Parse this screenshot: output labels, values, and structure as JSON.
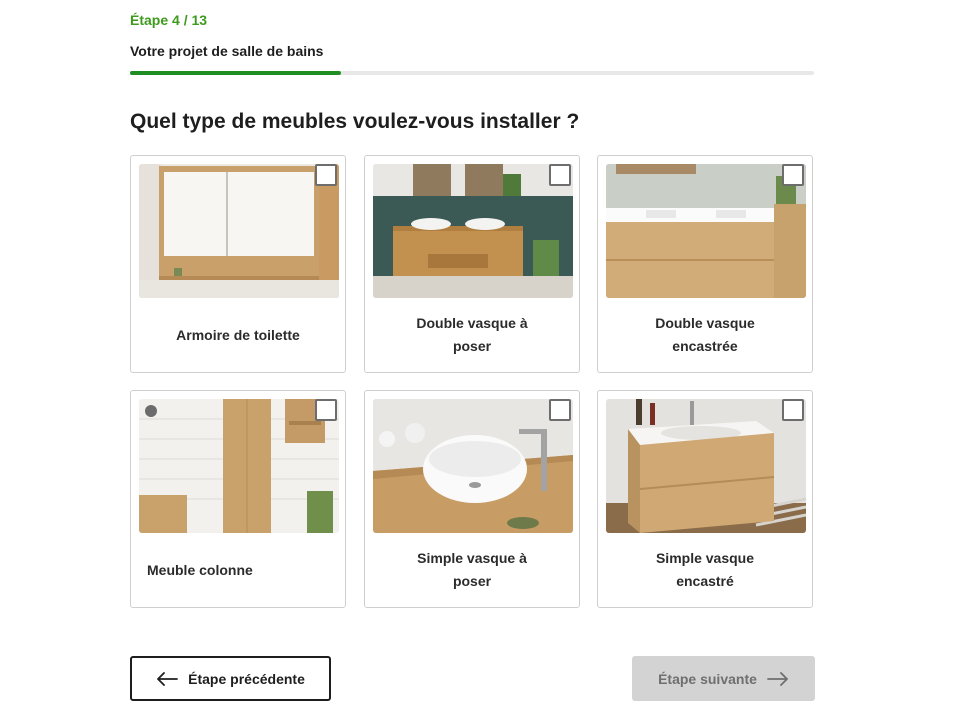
{
  "header": {
    "step": "Étape 4 / 13",
    "project_title": "Votre projet de salle de bains",
    "progress_fraction": 0.308
  },
  "question": "Quel type de meubles voulez-vous installer ?",
  "options": [
    {
      "label": "Armoire de toilette",
      "checked": false
    },
    {
      "label": "Double vasque à poser",
      "checked": false
    },
    {
      "label": "Double vasque encastrée",
      "checked": false
    },
    {
      "label": "Meuble colonne",
      "checked": false
    },
    {
      "label": "Simple vasque à poser",
      "checked": false
    },
    {
      "label": "Simple vasque encastré",
      "checked": false
    }
  ],
  "nav": {
    "prev_label": "Étape précédente",
    "next_label": "Étape suivante"
  },
  "colors": {
    "accent_green": "#3e9b1e",
    "progress_green": "#1f8f24",
    "disabled_button": "#d3d3d3"
  }
}
